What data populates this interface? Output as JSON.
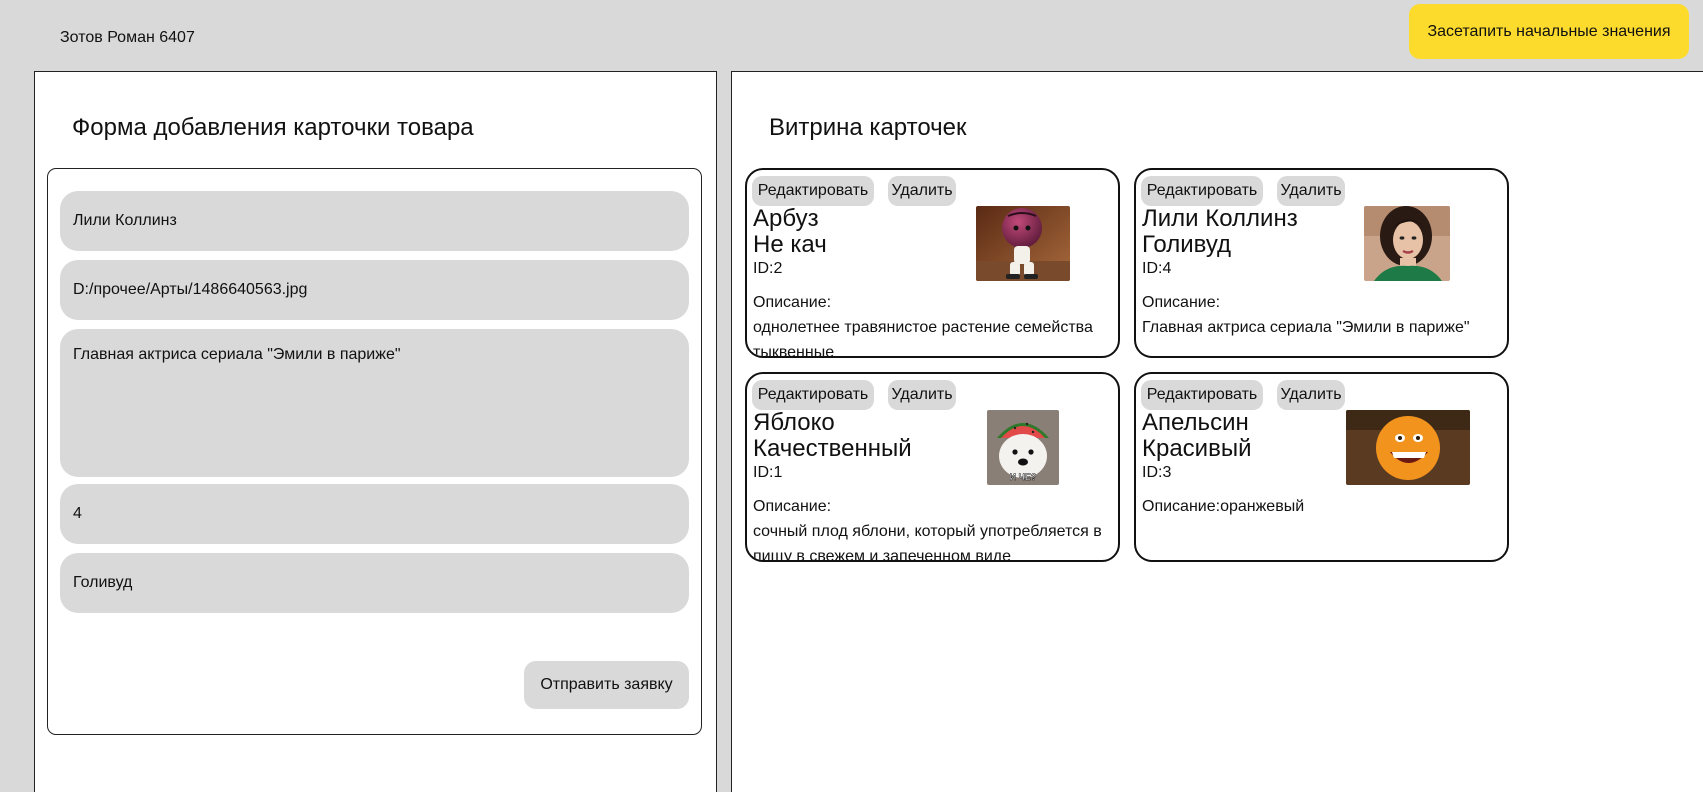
{
  "header": {
    "author": "Зотов Роман 6407",
    "reset_label": "Засетапить начальные значения",
    "accent": "#fcdb2c"
  },
  "form": {
    "title": "Форма добавления карточки товара",
    "name_value": "Лили Коллинз",
    "image_path_value": "D:/прочее/Арты/1486640563.jpg",
    "description_value": "Главная актриса сериала \"Эмили в париже\"",
    "id_value": "4",
    "subtitle_value": "Голивуд",
    "submit_label": "Отправить заявку"
  },
  "showcase": {
    "title": "Витрина карточек",
    "edit_label": "Редактировать",
    "delete_label": "Удалить",
    "cards": [
      {
        "title_line1": "Арбуз",
        "title_line2": "Не кач",
        "id": "ID:2",
        "description": "Описание:\nоднолетнее травянистое растение семейства тыквенные",
        "image": "watermelon-character-image"
      },
      {
        "title_line1": "Лили Коллинз",
        "title_line2": "Голивуд",
        "id": "ID:4",
        "description": "Описание:\nГлавная актриса сериала \"Эмили в париже\"",
        "image": "actress-portrait-image"
      },
      {
        "title_line1": "Яблоко",
        "title_line2": "Качественный",
        "id": "ID:1",
        "description": "Описание:\nсочный плод яблони, который употребляется в пищу в свежем и запеченном виде",
        "image": "dog-with-watermelon-helmet-meme-image"
      },
      {
        "title_line1": "Апельсин",
        "title_line2": "Красивый",
        "id": "ID:3",
        "description": "Описание:оранжевый",
        "image": "annoying-orange-image"
      }
    ]
  },
  "meme_caption": "И ЧЕ?"
}
